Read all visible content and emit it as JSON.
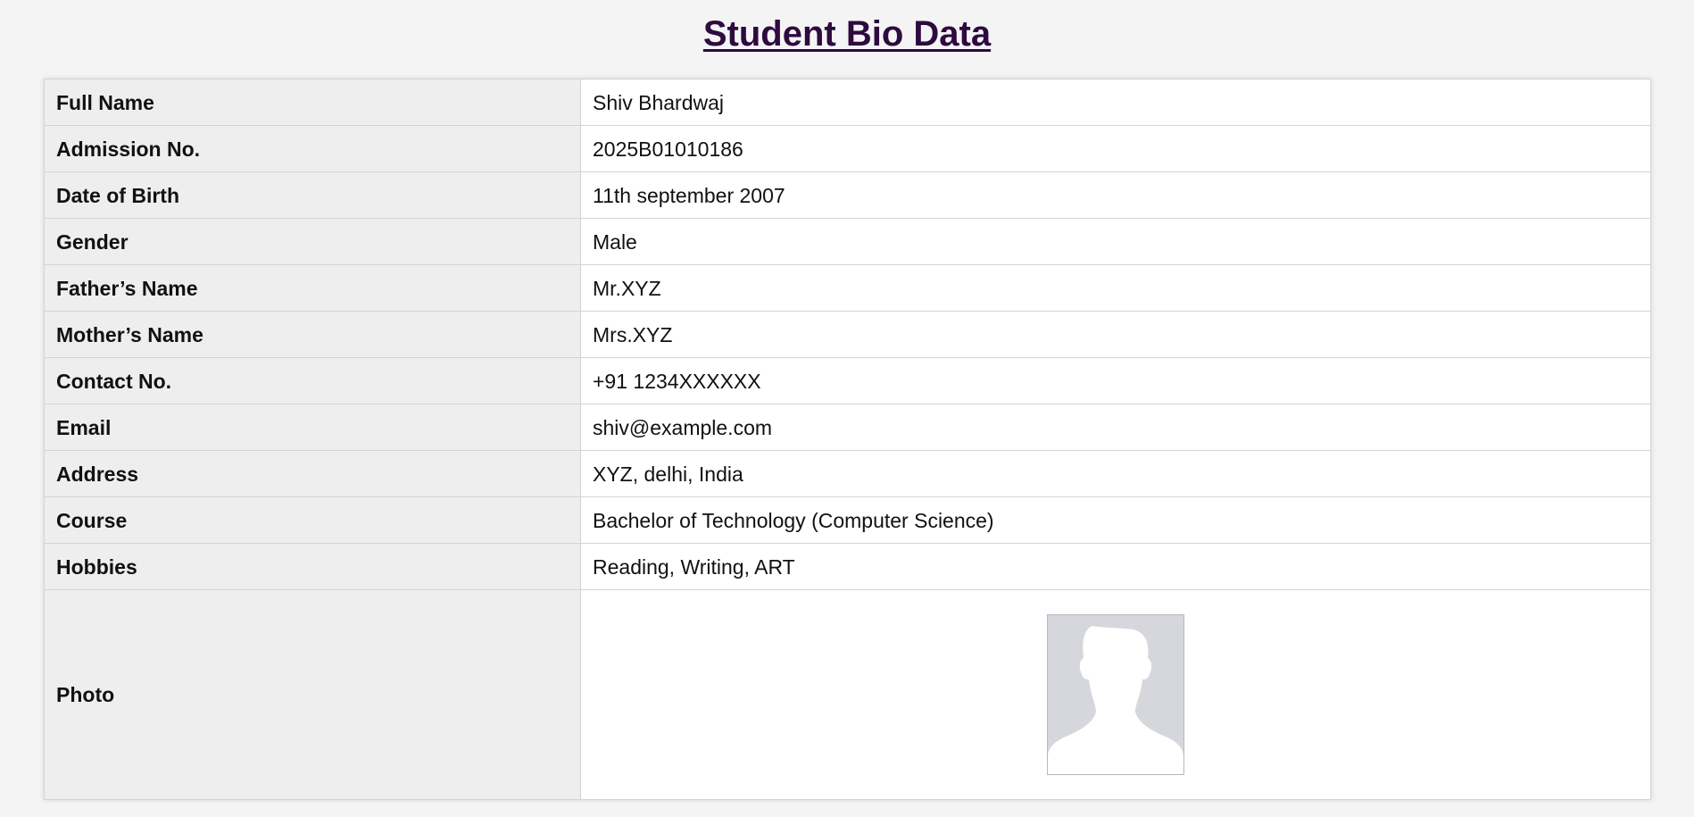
{
  "page": {
    "title": "Student Bio Data"
  },
  "fields": [
    {
      "label": "Full Name",
      "value": "Shiv Bhardwaj"
    },
    {
      "label": "Admission No.",
      "value": "2025B01010186"
    },
    {
      "label": "Date of Birth",
      "value": "11th september 2007"
    },
    {
      "label": "Gender",
      "value": "Male"
    },
    {
      "label": "Father’s Name",
      "value": "Mr.XYZ"
    },
    {
      "label": "Mother’s Name",
      "value": "Mrs.XYZ"
    },
    {
      "label": "Contact No.",
      "value": "+91 1234XXXXXX"
    },
    {
      "label": "Email",
      "value": "shiv@example.com"
    },
    {
      "label": "Address",
      "value": "XYZ, delhi, India"
    },
    {
      "label": "Course",
      "value": "Bachelor of Technology (Computer Science)"
    },
    {
      "label": "Hobbies",
      "value": "Reading, Writing, ART"
    }
  ],
  "photo": {
    "label": "Photo",
    "icon": "person-silhouette-icon"
  },
  "colors": {
    "title": "#2e0a40",
    "label_bg": "#eeeeee",
    "value_bg": "#ffffff",
    "page_bg": "#f4f4f4",
    "photo_bg": "#d6d7dc",
    "silhouette": "#ffffff"
  }
}
